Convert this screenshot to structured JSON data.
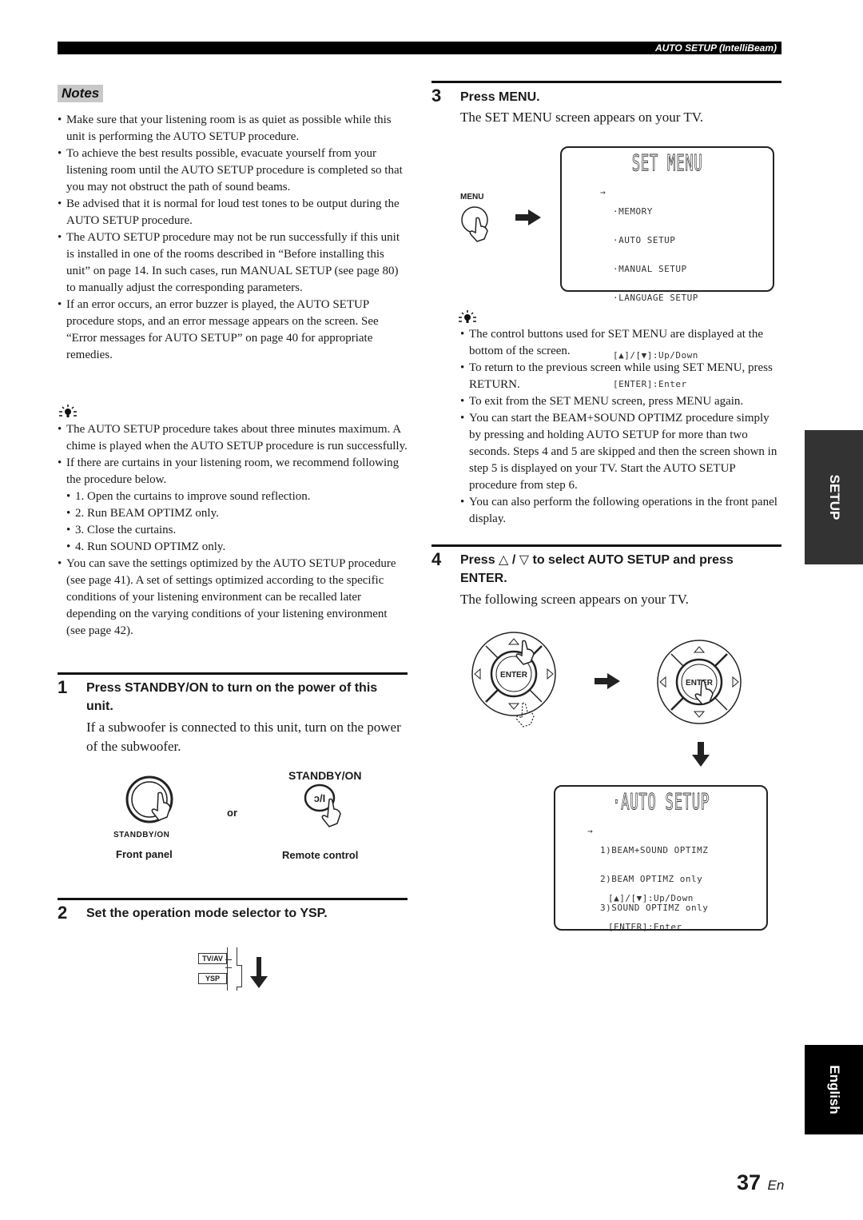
{
  "header": {
    "section_title": "AUTO SETUP (IntelliBeam)"
  },
  "notes": {
    "label": "Notes",
    "items": [
      "Make sure that your listening room is as quiet as possible while this unit is performing the AUTO SETUP procedure.",
      "To achieve the best results possible, evacuate yourself from your listening room until the AUTO SETUP procedure is completed so that you may not obstruct the path of sound beams.",
      "Be advised that it is normal for loud test tones to be output during the AUTO SETUP procedure.",
      "The AUTO SETUP procedure may not be run successfully if this unit is installed in one of the rooms described in “Before installing this unit” on page 14. In such cases, run MANUAL SETUP (see page 80) to manually adjust the corresponding parameters.",
      "If an error occurs, an error buzzer is played, the AUTO SETUP procedure stops, and an error message appears on the screen. See “Error messages for AUTO SETUP” on page 40 for appropriate remedies."
    ]
  },
  "tips_left": {
    "icon": "lightbulb-tip-icon",
    "item1": "The AUTO SETUP procedure takes about three minutes maximum. A chime is played when the AUTO SETUP procedure is run successfully.",
    "item2": "If there are curtains in your listening room, we recommend following the procedure below.",
    "sub_steps": [
      "1. Open the curtains to improve sound reflection.",
      "2. Run BEAM OPTIMZ only.",
      "3. Close the curtains.",
      "4. Run SOUND OPTIMZ only."
    ],
    "item3": "You can save the settings optimized by the AUTO SETUP procedure (see page 41). A set of settings optimized according to the specific conditions of your listening environment can be recalled later depending on the varying conditions of your listening environment (see page 42)."
  },
  "step1": {
    "number": "1",
    "heading": "Press STANDBY/ON to turn on the power of this unit.",
    "body": "If a subwoofer is connected to this unit, turn on the power of the subwoofer.",
    "front_button_label": "STANDBY/ON",
    "front_caption": "Front panel",
    "or": "or",
    "remote_button_label": "STANDBY/ON",
    "remote_button_glyph": "ↄ/I",
    "remote_caption": "Remote control"
  },
  "step2": {
    "number": "2",
    "heading": "Set the operation mode selector to YSP.",
    "selector_options": [
      "TV/AV",
      "YSP"
    ]
  },
  "step3": {
    "number": "3",
    "heading": "Press MENU.",
    "body": "The SET MENU screen appears on your TV.",
    "button_label": "MENU",
    "screen": {
      "title": "SET MENU",
      "cursor": "→",
      "items": [
        "·MEMORY",
        "·AUTO SETUP",
        "·MANUAL SETUP",
        "·LANGUAGE SETUP"
      ],
      "hint1": "[▲]/[▼]:Up/Down",
      "hint2": "[ENTER]:Enter"
    }
  },
  "tips_right": {
    "icon": "lightbulb-tip-icon",
    "items": [
      "The control buttons used for SET MENU are displayed at the bottom of the screen.",
      "To return to the previous screen while using SET MENU, press RETURN.",
      "To exit from the SET MENU screen, press MENU again.",
      "You can start the BEAM+SOUND OPTIMZ procedure simply by pressing and holding AUTO SETUP for more than two seconds. Steps 4 and 5 are skipped and then the screen shown in step 5 is displayed on your TV. Start the AUTO SETUP procedure from step 6.",
      "You can also perform the following operations in the front panel display."
    ]
  },
  "step4": {
    "number": "4",
    "heading_pre": "Press",
    "heading_up": "△",
    "heading_sep": "/",
    "heading_down": "▽",
    "heading_post": "to select AUTO SETUP and press ENTER.",
    "body": "The following screen appears on your TV.",
    "enter_label": "ENTER",
    "screen": {
      "title": "·AUTO SETUP",
      "cursor": "→",
      "items": [
        "1)BEAM+SOUND OPTIMZ",
        "2)BEAM OPTIMZ only",
        "3)SOUND OPTIMZ only"
      ],
      "hint1": "[▲]/[▼]:Up/Down",
      "hint2": "[ENTER]:Enter"
    }
  },
  "side_tabs": {
    "setup": "SETUP",
    "language": "English"
  },
  "footer": {
    "page_number": "37",
    "lang_suffix": "En"
  }
}
